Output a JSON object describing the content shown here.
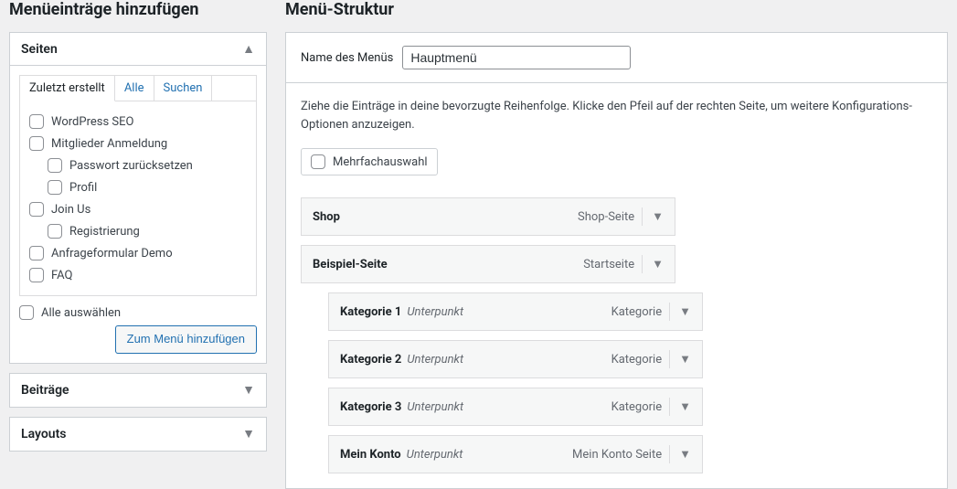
{
  "left": {
    "heading": "Menüeinträge hinzufügen",
    "pages": {
      "title": "Seiten",
      "tabs": {
        "recent": "Zuletzt erstellt",
        "all": "Alle",
        "search": "Suchen"
      },
      "items": [
        {
          "label": "WordPress SEO",
          "indent": 0
        },
        {
          "label": "Mitglieder Anmeldung",
          "indent": 0
        },
        {
          "label": "Passwort zurücksetzen",
          "indent": 1
        },
        {
          "label": "Profil",
          "indent": 1
        },
        {
          "label": "Join Us",
          "indent": 0
        },
        {
          "label": "Registrierung",
          "indent": 1
        },
        {
          "label": "Anfrageformular Demo",
          "indent": 0
        },
        {
          "label": "FAQ",
          "indent": 0
        }
      ],
      "select_all": "Alle auswählen",
      "add_button": "Zum Menü hinzufügen"
    },
    "posts_title": "Beiträge",
    "layouts_title": "Layouts"
  },
  "right": {
    "heading": "Menü-Struktur",
    "name_label": "Name des Menüs",
    "name_value": "Hauptmenü",
    "instructions": "Ziehe die Einträge in deine bevorzugte Reihenfolge. Klicke den Pfeil auf der rechten Seite, um weitere Konfigurations-Optionen anzuzeigen.",
    "bulk_label": "Mehrfachauswahl",
    "items": [
      {
        "title": "Shop",
        "sub": "",
        "type": "Shop-Seite",
        "depth": 0
      },
      {
        "title": "Beispiel-Seite",
        "sub": "",
        "type": "Startseite",
        "depth": 0
      },
      {
        "title": "Kategorie 1",
        "sub": "Unterpunkt",
        "type": "Kategorie",
        "depth": 1
      },
      {
        "title": "Kategorie 2",
        "sub": "Unterpunkt",
        "type": "Kategorie",
        "depth": 1
      },
      {
        "title": "Kategorie 3",
        "sub": "Unterpunkt",
        "type": "Kategorie",
        "depth": 1
      },
      {
        "title": "Mein Konto",
        "sub": "Unterpunkt",
        "type": "Mein Konto Seite",
        "depth": 1
      }
    ]
  }
}
